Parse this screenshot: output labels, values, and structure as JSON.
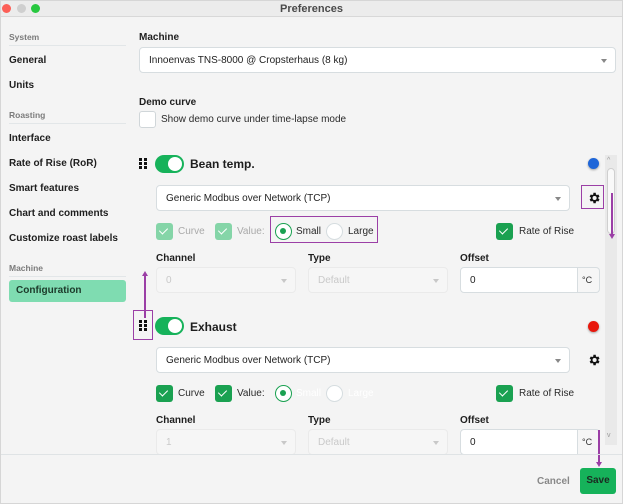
{
  "window": {
    "title": "Preferences"
  },
  "sidebar": {
    "sections": [
      {
        "label": "System",
        "items": [
          {
            "label": "General"
          },
          {
            "label": "Units"
          }
        ]
      },
      {
        "label": "Roasting",
        "items": [
          {
            "label": "Interface"
          },
          {
            "label": "Rate of Rise (RoR)"
          },
          {
            "label": "Smart features"
          },
          {
            "label": "Chart and comments"
          },
          {
            "label": "Customize roast labels"
          }
        ]
      },
      {
        "label": "Machine",
        "items": [
          {
            "label": "Configuration",
            "active": true
          }
        ]
      }
    ]
  },
  "main": {
    "machine": {
      "label": "Machine",
      "value": "Innoenvas TNS-8000 @ Cropsterhaus (8 kg)"
    },
    "demo_curve": {
      "label": "Demo curve",
      "checkbox_label": "Show demo curve under time-lapse mode",
      "checked": false
    },
    "sensors": [
      {
        "name": "Bean temp.",
        "enabled": true,
        "color": "#1f66d8",
        "source": "Generic Modbus over Network (TCP)",
        "curve_label": "Curve",
        "curve_checked": true,
        "value_label": "Value:",
        "value_checked": true,
        "size_options": [
          "Small",
          "Large"
        ],
        "size_selected": "Small",
        "ror_label": "Rate of Rise",
        "ror_checked": true,
        "channel_label": "Channel",
        "channel_value": "0",
        "type_label": "Type",
        "type_value": "Default",
        "offset_label": "Offset",
        "offset_value": "0",
        "offset_unit": "°C"
      },
      {
        "name": "Exhaust",
        "enabled": true,
        "color": "#e8170c",
        "source": "Generic Modbus over Network (TCP)",
        "curve_label": "Curve",
        "curve_checked": true,
        "value_label": "Value:",
        "value_checked": true,
        "size_options": [
          "Small",
          "Large"
        ],
        "size_selected": "Small",
        "ror_label": "Rate of Rise",
        "ror_checked": true,
        "channel_label": "Channel",
        "channel_value": "1",
        "type_label": "Type",
        "type_value": "Default",
        "offset_label": "Offset",
        "offset_value": "0",
        "offset_unit": "°C"
      }
    ]
  },
  "footer": {
    "cancel_label": "Cancel",
    "save_label": "Save"
  },
  "colors": {
    "accent": "#16b25a",
    "annotation": "#9b3fa6",
    "active_nav": "#7fdcb1"
  }
}
